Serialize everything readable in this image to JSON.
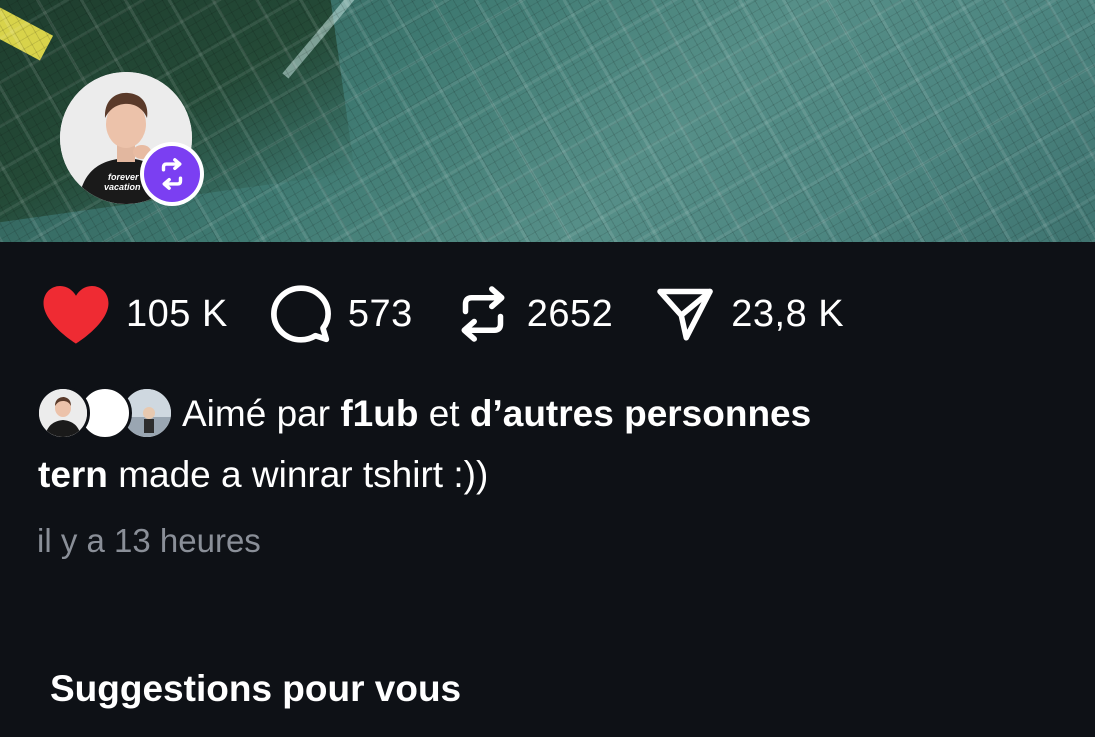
{
  "post": {
    "avatar_icon": "person-photo-icon",
    "repost_badge_icon": "repost-icon",
    "brand_colors": {
      "like": "#ef2b33",
      "repost_badge": "#7b3ff2",
      "background": "#0e1116",
      "muted_text": "#8a8f98"
    }
  },
  "actions": {
    "likes": "105 K",
    "comments": "573",
    "reposts": "2652",
    "shares": "23,8 K"
  },
  "liked_by": {
    "prefix": "Aimé par",
    "user": "f1ub",
    "connector": "et",
    "others": "d’autres personnes"
  },
  "caption": {
    "author": "tern",
    "text": "made a winrar tshirt :))"
  },
  "timestamp": "il y a 13 heures",
  "suggestions_title": "Suggestions pour vous"
}
